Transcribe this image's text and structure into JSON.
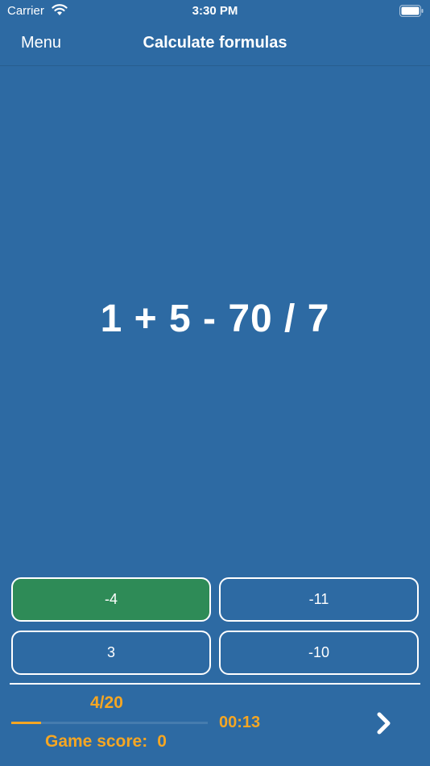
{
  "status_bar": {
    "carrier": "Carrier",
    "time": "3:30 PM",
    "wifi_icon": "wifi-icon",
    "battery_icon": "battery-icon"
  },
  "nav": {
    "menu_label": "Menu",
    "title": "Calculate formulas"
  },
  "formula": "1 + 5 - 70 / 7",
  "answers": [
    {
      "label": "-4",
      "selected": true
    },
    {
      "label": "-11",
      "selected": false
    },
    {
      "label": "3",
      "selected": false
    },
    {
      "label": "-10",
      "selected": false
    }
  ],
  "footer": {
    "progress_text": "4/20",
    "progress_fraction": 0.15,
    "timer": "00:13",
    "score_label": "Game score:",
    "score_value": "0",
    "next_icon": "chevron-right-icon"
  },
  "colors": {
    "background": "#2d6aa3",
    "selected_answer": "#2e8b57",
    "accent": "#f5a623",
    "text": "#ffffff"
  }
}
